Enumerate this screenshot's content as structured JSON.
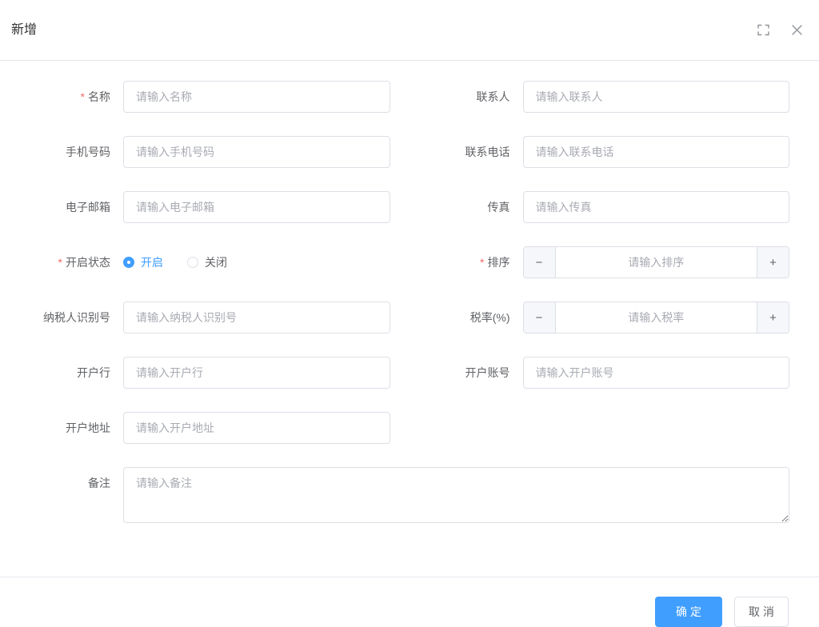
{
  "dialog": {
    "title": "新增"
  },
  "icons": {
    "fullscreen": "corner-brackets",
    "close": "x-mark",
    "minus": "−",
    "plus": "+"
  },
  "form": {
    "required_mark": "*",
    "fields": {
      "name": {
        "label": "名称",
        "placeholder": "请输入名称",
        "required": true
      },
      "contact": {
        "label": "联系人",
        "placeholder": "请输入联系人"
      },
      "mobile": {
        "label": "手机号码",
        "placeholder": "请输入手机号码"
      },
      "phone": {
        "label": "联系电话",
        "placeholder": "请输入联系电话"
      },
      "email": {
        "label": "电子邮箱",
        "placeholder": "请输入电子邮箱"
      },
      "fax": {
        "label": "传真",
        "placeholder": "请输入传真"
      },
      "status": {
        "label": "开启状态",
        "required": true,
        "options": [
          {
            "label": "开启",
            "selected": true
          },
          {
            "label": "关闭",
            "selected": false
          }
        ]
      },
      "sort": {
        "label": "排序",
        "placeholder": "请输入排序",
        "required": true,
        "type": "number"
      },
      "taxpayer_id": {
        "label": "纳税人识别号",
        "placeholder": "请输入纳税人识别号"
      },
      "tax_rate": {
        "label": "税率(%)",
        "placeholder": "请输入税率",
        "type": "number"
      },
      "bank": {
        "label": "开户行",
        "placeholder": "请输入开户行"
      },
      "bank_account": {
        "label": "开户账号",
        "placeholder": "请输入开户账号"
      },
      "bank_address": {
        "label": "开户地址",
        "placeholder": "请输入开户地址"
      },
      "remark": {
        "label": "备注",
        "placeholder": "请输入备注",
        "type": "textarea"
      }
    }
  },
  "footer": {
    "confirm_label": "确定",
    "cancel_label": "取消"
  },
  "colors": {
    "primary": "#409eff",
    "danger": "#f56c6c",
    "border": "#dcdfe6",
    "divider": "#e4e7ed",
    "label_text": "#606266",
    "title_text": "#303133",
    "placeholder_text": "#a8abb2",
    "control_bg": "#f5f7fa",
    "icon_gray": "#909399"
  }
}
